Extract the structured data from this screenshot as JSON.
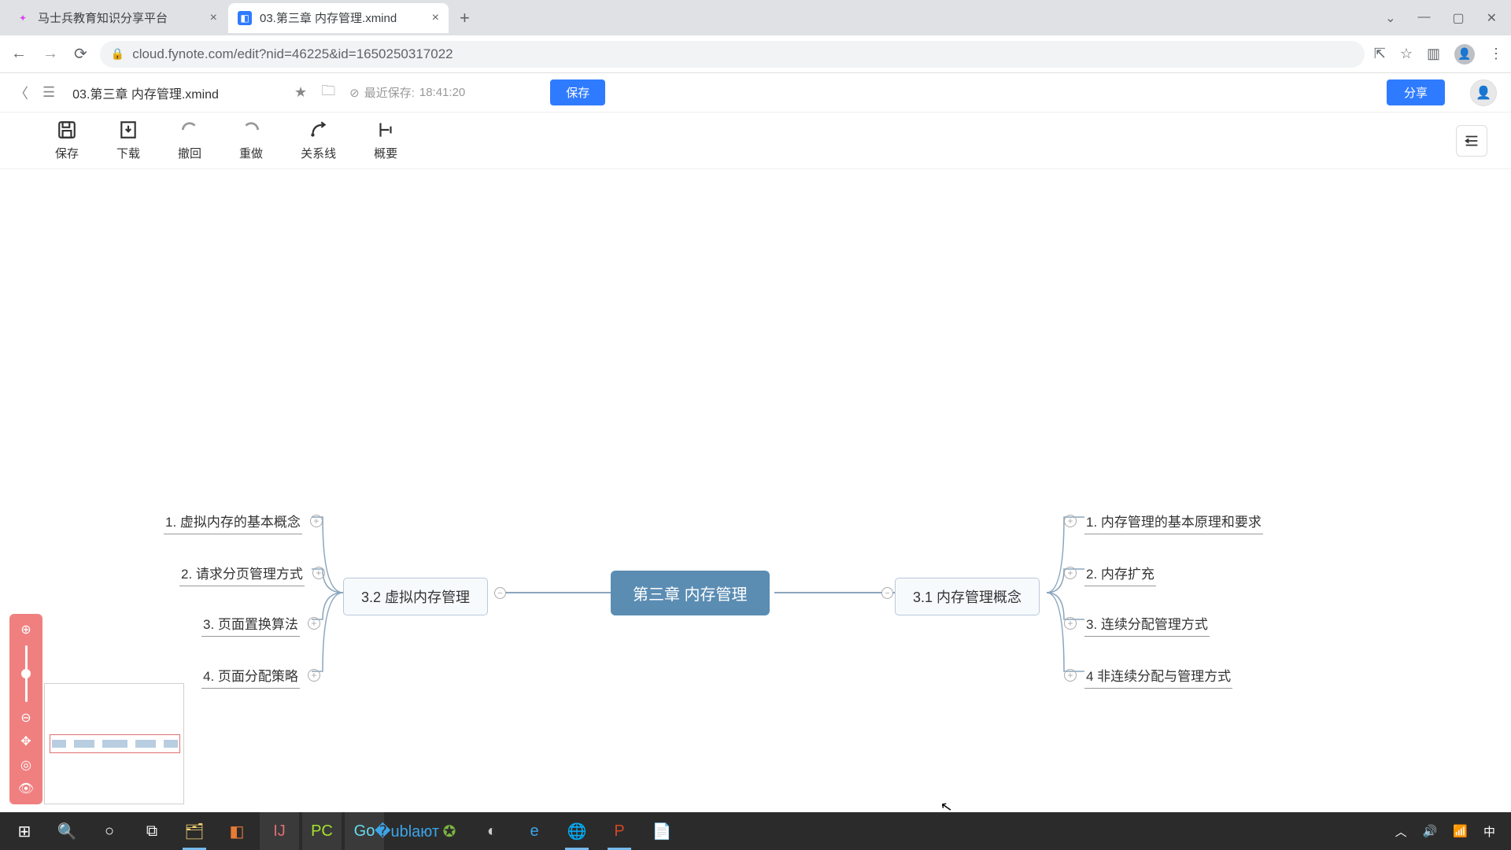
{
  "browser": {
    "tabs": [
      {
        "title": "马士兵教育知识分享平台",
        "active": false
      },
      {
        "title": "03.第三章 内存管理.xmind",
        "active": true
      }
    ],
    "url": "cloud.fynote.com/edit?nid=46225&id=1650250317022"
  },
  "app": {
    "doc_title": "03.第三章 内存管理.xmind",
    "last_saved_label": "最近保存:",
    "last_saved_time": "18:41:20",
    "save_btn": "保存",
    "share_btn": "分享"
  },
  "toolbar": {
    "save": "保存",
    "download": "下载",
    "undo": "撤回",
    "redo": "重做",
    "relation": "关系线",
    "summary": "概要"
  },
  "mindmap": {
    "central": "第三章 内存管理",
    "left_branch": "3.2 虚拟内存管理",
    "right_branch": "3.1 内存管理概念",
    "left_leaves": [
      "1. 虚拟内存的基本概念",
      "2. 请求分页管理方式",
      "3. 页面置换算法",
      "4. 页面分配策略"
    ],
    "right_leaves": [
      "1. 内存管理的基本原理和要求",
      "2. 内存扩充",
      "3. 连续分配管理方式",
      "4 非连续分配与管理方式"
    ]
  },
  "tray": {
    "ime": "中"
  }
}
